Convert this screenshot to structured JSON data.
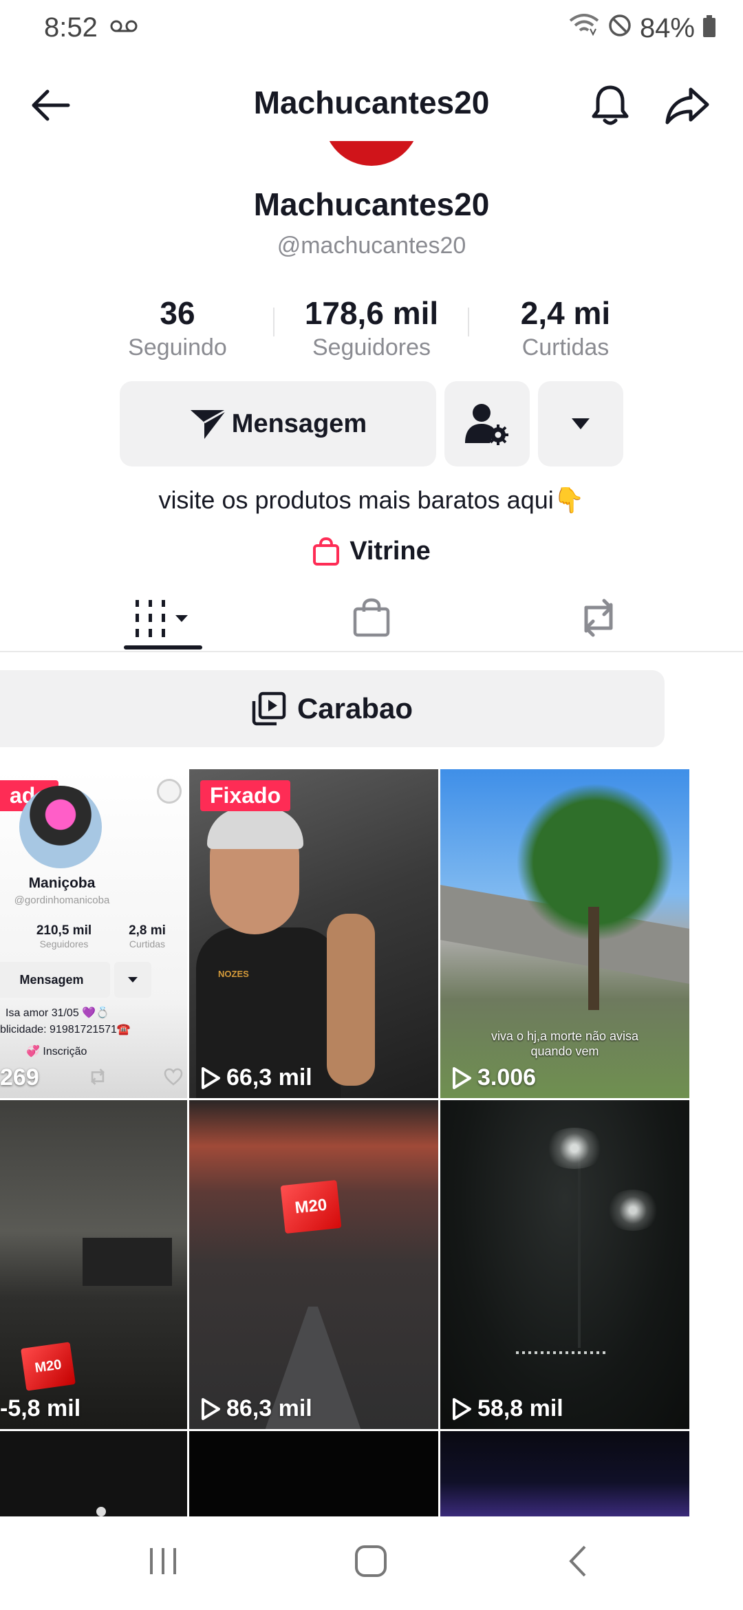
{
  "status_bar": {
    "time": "8:52",
    "battery": "84%"
  },
  "header": {
    "title": "Machucantes20"
  },
  "profile": {
    "name": "Machucantes20",
    "handle": "@machucantes20",
    "stats": [
      {
        "value": "36",
        "label": "Seguindo"
      },
      {
        "value": "178,6 mil",
        "label": "Seguidores"
      },
      {
        "value": "2,4 mi",
        "label": "Curtidas"
      }
    ],
    "message_button": "Mensagem",
    "bio": "visite os produtos mais baratos  aqui👇",
    "showcase": "Vitrine"
  },
  "playlist": {
    "label": "Carabao"
  },
  "grid": [
    {
      "pinned_label": "ado",
      "views": "269",
      "mini_profile": {
        "name": "Maniçoba",
        "handle": "@gordinhomanicoba",
        "stats": [
          {
            "value": "210,5 mil",
            "label": "Seguidores"
          },
          {
            "value": "2,8 mi",
            "label": "Curtidas"
          }
        ],
        "button": "Mensagem",
        "bio_line1": "Isa amor 31/05 💜💍",
        "bio_line2": "blicidade: 91981721571☎️",
        "link": "💞 Inscrição"
      }
    },
    {
      "pinned_label": "Fixado",
      "views": "66,3 mil",
      "shirt_text": "NOZES"
    },
    {
      "views": "3.006",
      "caption_line1": "viva o hj,a morte não avisa",
      "caption_line2": "quando vem"
    },
    {
      "views": "-5,8 mil",
      "logo": "M20"
    },
    {
      "views": "86,3 mil",
      "logo": "M20"
    },
    {
      "views": "58,8 mil"
    }
  ],
  "colors": {
    "accent": "#fe2c55",
    "text": "#161823",
    "muted": "#8a8b91",
    "button_bg": "#f1f1f2"
  }
}
